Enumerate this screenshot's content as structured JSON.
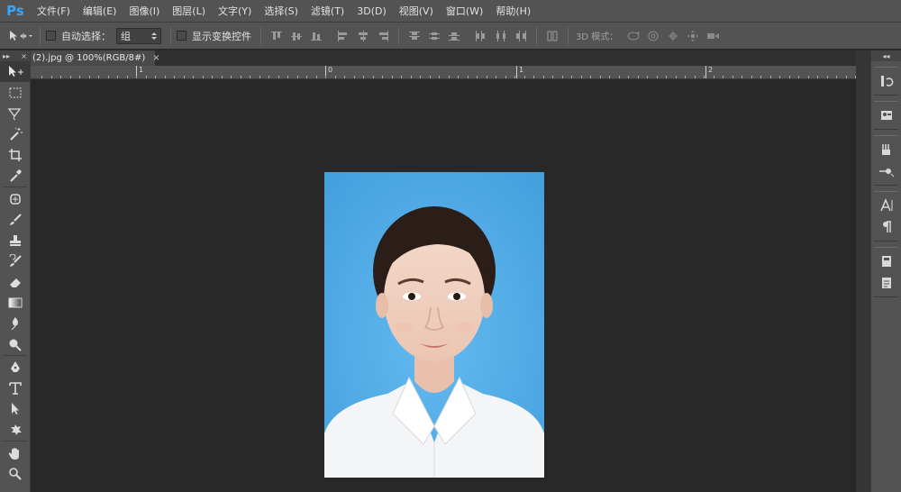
{
  "app": {
    "logo": "Ps"
  },
  "menu": [
    "文件(F)",
    "编辑(E)",
    "图像(I)",
    "图层(L)",
    "文字(Y)",
    "选择(S)",
    "滤镜(T)",
    "3D(D)",
    "视图(V)",
    "窗口(W)",
    "帮助(H)"
  ],
  "options": {
    "auto_select_label": "自动选择：",
    "auto_select_value": "组",
    "show_transform_label": "显示变换控件",
    "mode_3d_label": "3D 模式："
  },
  "document": {
    "tab_title": "(2).jpg @ 100%(RGB/8#)",
    "close_glyph": "×"
  },
  "ruler": {
    "labels": [
      "1",
      "0",
      "1",
      "2"
    ]
  },
  "toolbar": {
    "head_left": "▸▸",
    "head_right": "×"
  },
  "right_panel": {
    "head": "◂◂"
  },
  "colors": {
    "accent": "#31a8ff",
    "photo_bg": "#55acea",
    "ui_bg": "#535353",
    "canvas_bg": "#282828"
  }
}
